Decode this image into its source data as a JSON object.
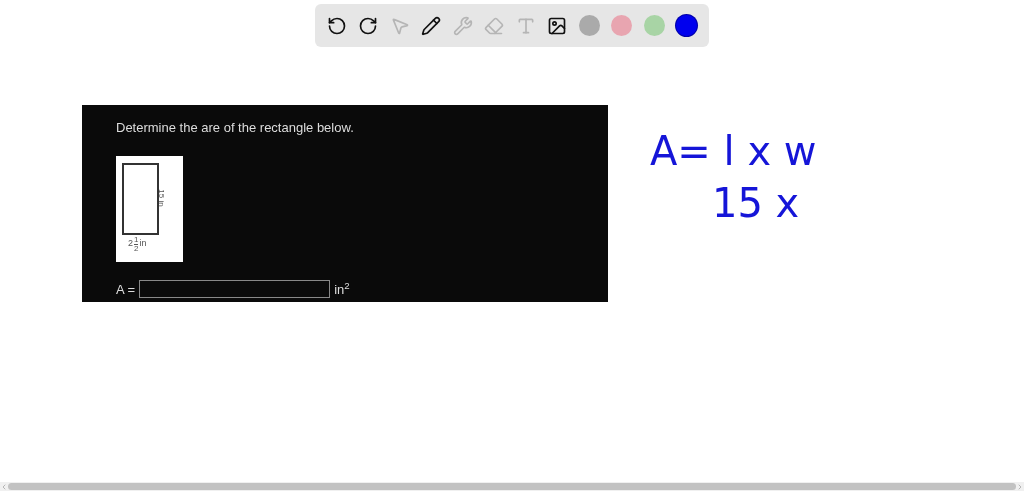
{
  "toolbar": {
    "tools": [
      {
        "kind": "undo",
        "disabled": false
      },
      {
        "kind": "redo",
        "disabled": false
      },
      {
        "kind": "select",
        "disabled": true
      },
      {
        "kind": "pen",
        "disabled": false
      },
      {
        "kind": "tools",
        "disabled": true
      },
      {
        "kind": "eraser",
        "disabled": true
      },
      {
        "kind": "text",
        "disabled": true
      },
      {
        "kind": "image",
        "disabled": false
      }
    ],
    "colors": [
      {
        "color": "#aaaaaa",
        "selected": false
      },
      {
        "color": "#e8a5b0",
        "selected": false
      },
      {
        "color": "#a8d4a5",
        "selected": false
      },
      {
        "color": "#0000ee",
        "selected": true
      }
    ]
  },
  "question": {
    "prompt": "Determine the are of the rectangle below.",
    "figure": {
      "height_label": "15 in",
      "width_whole": "2",
      "width_numerator": "1",
      "width_denominator": "2",
      "width_unit": "in"
    },
    "answer_label": "A =",
    "answer_unit": "in$^{2}$"
  },
  "handwriting": [
    "A= l x w",
    "15 x"
  ]
}
